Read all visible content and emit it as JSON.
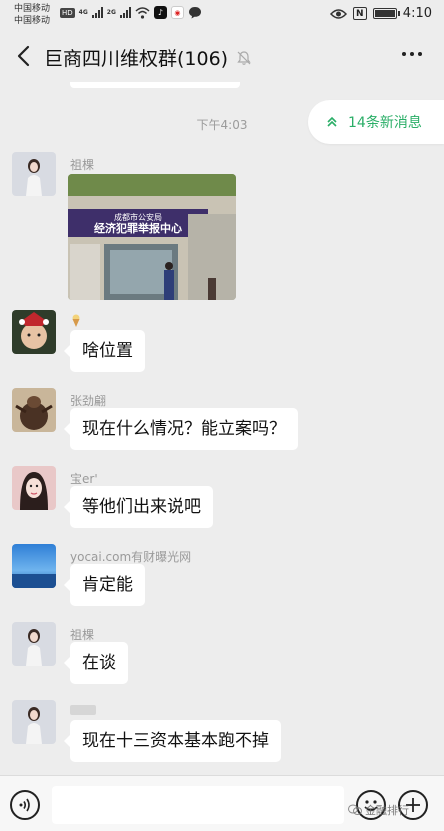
{
  "status_bar": {
    "carrier_1": "中国移动",
    "carrier_2": "中国移动",
    "hd_badge": "HD",
    "net_1": "4G",
    "net_2": "2G",
    "nfc": "N",
    "time": "4:10",
    "battery_level": 0.9
  },
  "header": {
    "title": "巨商四川维权群(106)"
  },
  "chat": {
    "timestamp": "下午4:03",
    "new_messages": "14条新消息",
    "messages": [
      {
        "sender": "祖棵",
        "type": "image"
      },
      {
        "sender": "",
        "text": "啥位置"
      },
      {
        "sender": "张劲翩",
        "text": "现在什么情况？能立案吗？"
      },
      {
        "sender": "宝er'",
        "text": "等他们出来说吧"
      },
      {
        "sender": "yocai.com有财曝光网",
        "text": "肯定能"
      },
      {
        "sender": "祖棵",
        "text": "在谈"
      },
      {
        "sender": "",
        "text": "现在十三资本基本跑不掉"
      }
    ],
    "photo_sign_top": "成都市公安局",
    "photo_sign_main": "经济犯罪举报中心"
  },
  "watermark": "金融排行",
  "colors": {
    "accent_green": "#2aae67",
    "background": "#ededed",
    "bubble": "#ffffff"
  }
}
